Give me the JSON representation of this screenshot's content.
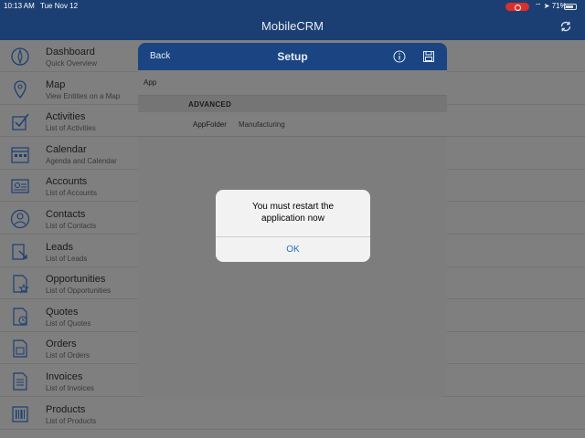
{
  "status_bar": {
    "time": "10:13 AM",
    "date": "Tue Nov 12",
    "battery": "71%"
  },
  "app": {
    "title": "MobileCRM"
  },
  "sidebar": {
    "items": [
      {
        "title": "Dashboard",
        "subtitle": "Quick Overview",
        "icon": "compass-icon"
      },
      {
        "title": "Map",
        "subtitle": "View Entities on a Map",
        "icon": "map-pin-icon"
      },
      {
        "title": "Activities",
        "subtitle": "List of Activities",
        "icon": "checklist-icon"
      },
      {
        "title": "Calendar",
        "subtitle": "Agenda and Calendar",
        "icon": "calendar-icon"
      },
      {
        "title": "Accounts",
        "subtitle": "List of Accounts",
        "icon": "id-card-icon"
      },
      {
        "title": "Contacts",
        "subtitle": "List of Contacts",
        "icon": "person-icon"
      },
      {
        "title": "Leads",
        "subtitle": "List of Leads",
        "icon": "lead-icon"
      },
      {
        "title": "Opportunities",
        "subtitle": "List of Opportunities",
        "icon": "star-document-icon"
      },
      {
        "title": "Quotes",
        "subtitle": "List of Quotes",
        "icon": "quote-icon"
      },
      {
        "title": "Orders",
        "subtitle": "List of Orders",
        "icon": "order-icon"
      },
      {
        "title": "Invoices",
        "subtitle": "List of Invoices",
        "icon": "invoice-icon"
      },
      {
        "title": "Products",
        "subtitle": "List of Products",
        "icon": "barcode-icon"
      }
    ]
  },
  "setup": {
    "back_label": "Back",
    "title": "Setup",
    "app_label": "App",
    "section": "ADVANCED",
    "field_label": "AppFolder",
    "field_value": "Manufacturing"
  },
  "alert": {
    "line1": "You must restart the",
    "line2": "application now",
    "ok_label": "OK"
  },
  "colors": {
    "nav": "#1c3f73",
    "dialog_header": "#1a4582",
    "accent": "#1f6fd0"
  }
}
